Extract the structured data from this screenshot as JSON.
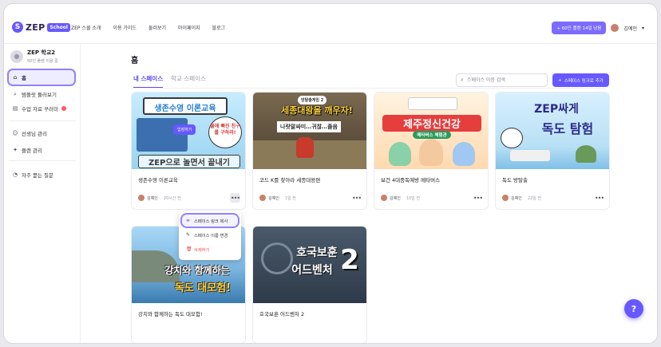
{
  "logo": {
    "brand": "ZEP",
    "badge": "School"
  },
  "nav": [
    "ZEP 스쿨 소개",
    "이용 가이드",
    "둘러보기",
    "마이페이지",
    "블로그"
  ],
  "top_right": {
    "trial": "+ 60인 플랜 14일 남음",
    "user": "김예인"
  },
  "sidebar": {
    "school_name": "ZEP 학교2",
    "school_sub": "50인 플랜 이용 중",
    "items": [
      {
        "label": "홈",
        "icon": "home-icon"
      },
      {
        "label": "템플릿 둘러보기",
        "icon": "search-icon"
      },
      {
        "label": "수업 자료 꾸러미",
        "icon": "book-icon"
      },
      {
        "label": "선생님 관리",
        "icon": "users-icon"
      },
      {
        "label": "플랜 관리",
        "icon": "plan-icon"
      },
      {
        "label": "자주 묻는 질문",
        "icon": "question-icon"
      }
    ]
  },
  "main": {
    "title": "홈",
    "tabs": [
      "내 스페이스",
      "학교 스페이스"
    ],
    "search_placeholder": "스페이스 이름 검색",
    "add_button": "스페이스 링크로 추가"
  },
  "cards": [
    {
      "title": "생존수영 이론교육",
      "author": "김예인",
      "date": "20시간 전",
      "thumb_title": "생존수영 이론교육",
      "thumb_sub": "ZEP으로 놀면서 끝내기",
      "thumb_btn": "입장하기",
      "bubble": "물에 빠진 친구를 구하라!",
      "accent": "#9ad3f0"
    },
    {
      "title": "코드 K를 찾아라 세종대왕편",
      "author": "김예인",
      "date": "1일 전",
      "thumb_title": "세종대왕을 깨우자!",
      "thumb_kicker": "방탈출게임 2",
      "thumb_sub": "나랏말싸미…귀찮…졸음",
      "accent": "#5a4a3a"
    },
    {
      "title": "보건 4대중독예방 메타버스",
      "author": "김예인",
      "date": "10일 전",
      "thumb_title": "제주정신건강",
      "thumb_sub": "메타버스 체험관",
      "accent": "#e63d3d"
    },
    {
      "title": "독도 방탈출",
      "author": "김예인",
      "date": "22일 전",
      "thumb_title": "ZEP싸게",
      "thumb_title2": "독도 탐험",
      "accent": "#b8e0f5"
    },
    {
      "title": "강치와 함께하는 독도 대모험!",
      "thumb_title": "강치와 함께하는",
      "thumb_title2": "독도 대모험!",
      "accent": "#7bb6e0"
    },
    {
      "title": "호국보훈 어드벤처 2",
      "thumb_title": "호국보훈",
      "thumb_title2": "어드벤처",
      "thumb_num": "2",
      "accent": "#2e3a4a"
    }
  ],
  "context_menu": [
    "스페이스 링크 복사",
    "스페이스 이름 변경",
    "삭제하기"
  ],
  "help": "?"
}
